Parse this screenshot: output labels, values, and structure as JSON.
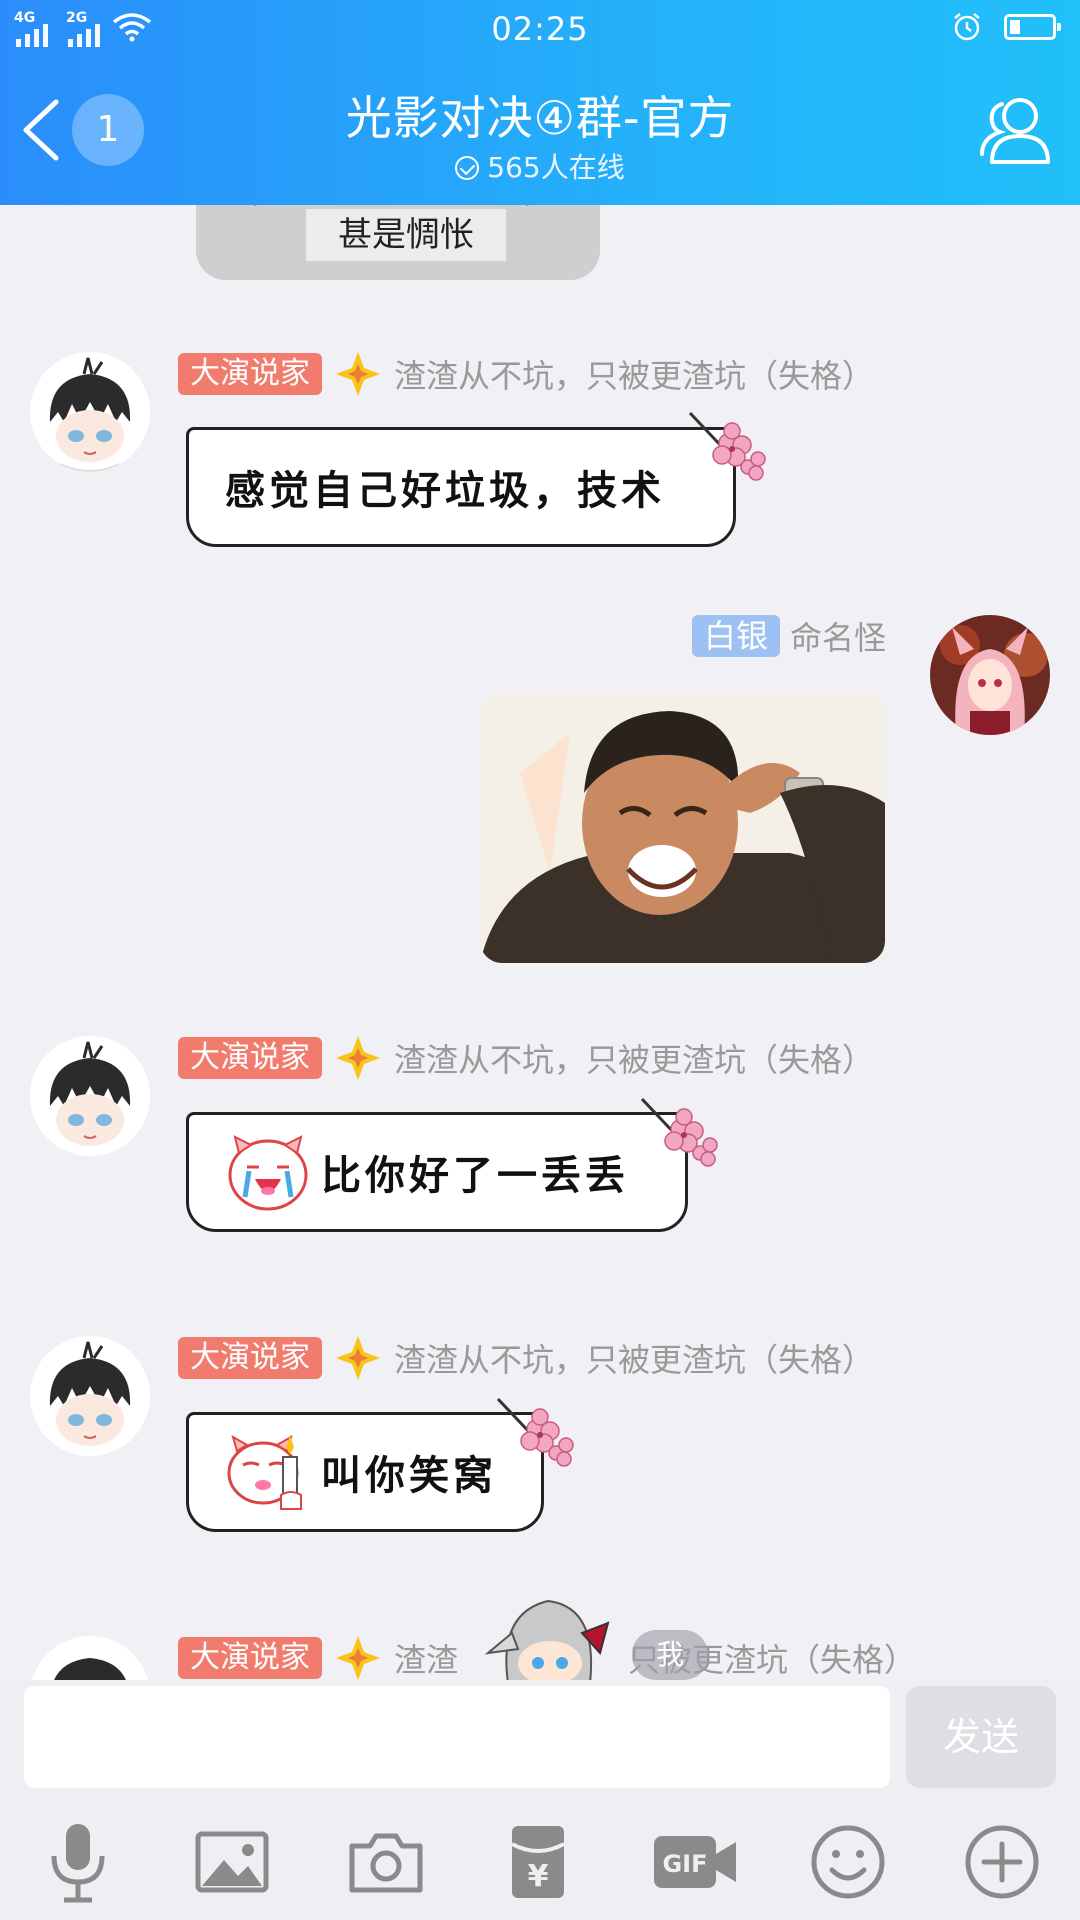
{
  "status_bar": {
    "time": "02:25",
    "network_1": "4G",
    "network_2": "2G",
    "battery_level": 0.25
  },
  "header": {
    "unread_count": "1",
    "title": "光影对决④群-官方",
    "online_text": "565人在线",
    "icons": [
      "back-arrow-icon",
      "members-icon"
    ]
  },
  "chat": {
    "previous_image_caption": "甚是惆怅",
    "messages": [
      {
        "side": "left",
        "title_badge": "大演说家",
        "nickname": "渣渣从不坑，只被更渣坑（失格）",
        "text": "感觉自己好垃圾，技术"
      },
      {
        "side": "right",
        "rank_badge": "白银",
        "nickname": "命名怪",
        "image": "crying-laughing-man-meme"
      },
      {
        "side": "left",
        "title_badge": "大演说家",
        "nickname": "渣渣从不坑，只被更渣坑（失格）",
        "emoji": "crying-pig-emoji",
        "text": "比你好了一丢丢"
      },
      {
        "side": "left",
        "title_badge": "大演说家",
        "nickname": "渣渣从不坑，只被更渣坑（失格）",
        "emoji": "thumbs-up-pig-emoji",
        "text": "叫你笑窝"
      },
      {
        "side": "left",
        "title_badge": "大演说家",
        "nickname_visible_start": "渣渣",
        "nickname_visible_end": "只被更渣坑（失格）"
      }
    ],
    "floating_me_label": "我"
  },
  "input": {
    "placeholder": "",
    "value": "",
    "send_label": "发送"
  },
  "toolbar": {
    "icons": [
      "microphone-icon",
      "image-icon",
      "camera-icon",
      "red-envelope-icon",
      "gif-icon",
      "emoji-icon",
      "plus-icon"
    ],
    "gif_label": "GIF",
    "red_envelope_symbol": "¥"
  },
  "colors": {
    "header_start": "#2a8dfb",
    "header_end": "#21c0fa",
    "title_badge": "#f17b6d",
    "rank_badge": "#9cc1f2",
    "chat_bg": "#f0f0f5"
  }
}
